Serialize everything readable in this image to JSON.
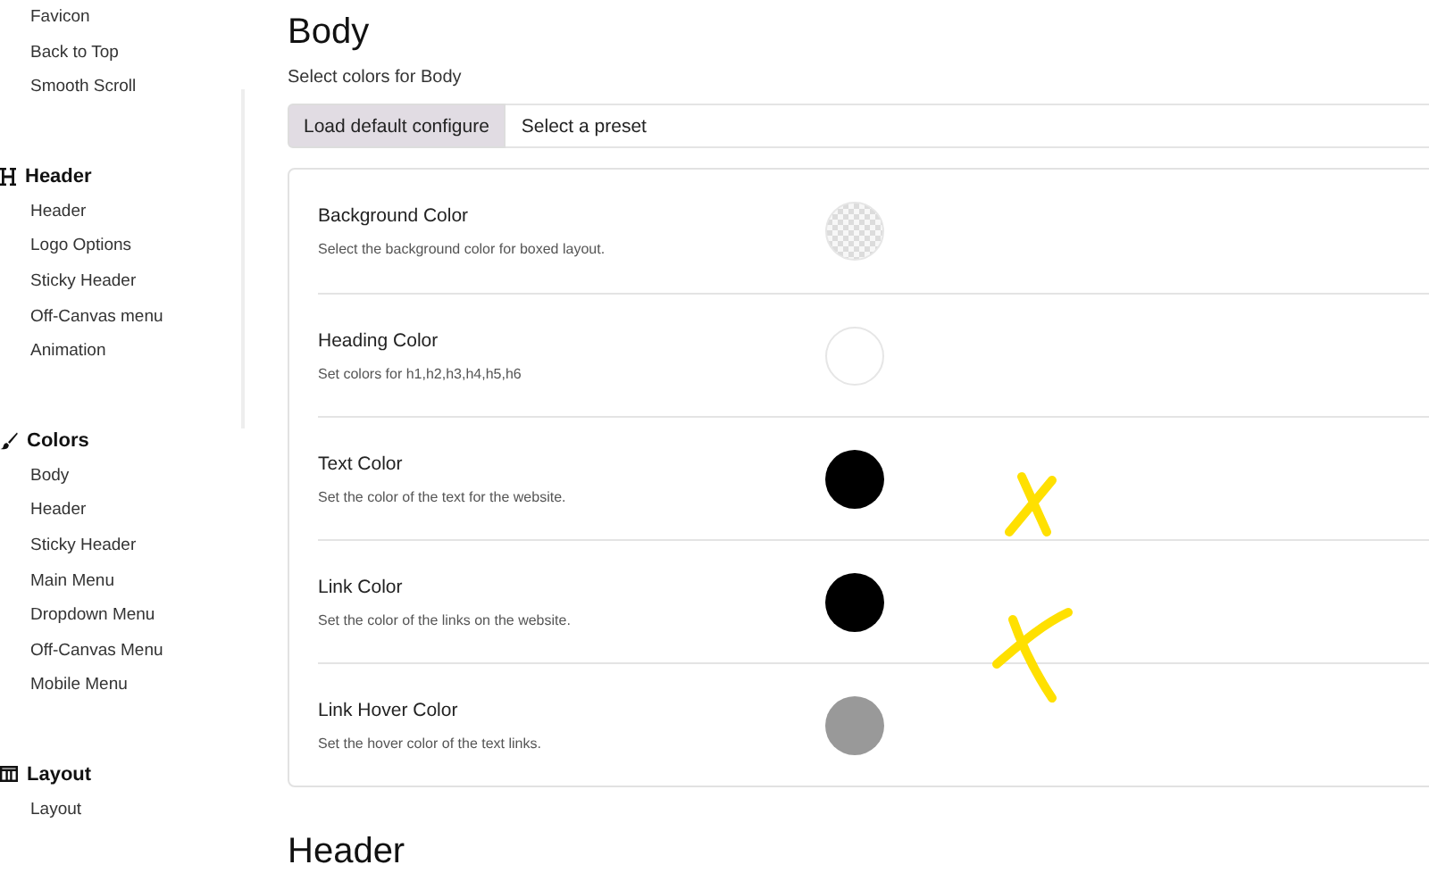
{
  "sidebar": {
    "top_items": [
      "Favicon",
      "Back to Top",
      "Smooth Scroll"
    ],
    "groups": [
      {
        "title": "Header",
        "items": [
          "Header",
          "Logo Options",
          "Sticky Header",
          "Off-Canvas menu",
          "Animation"
        ]
      },
      {
        "title": "Colors",
        "items": [
          "Body",
          "Header",
          "Sticky Header",
          "Main Menu",
          "Dropdown Menu",
          "Off-Canvas Menu",
          "Mobile Menu"
        ]
      },
      {
        "title": "Layout",
        "items": [
          "Layout"
        ]
      }
    ]
  },
  "section": {
    "title": "Body",
    "subtitle": "Select colors for Body",
    "default_button": "Load default configure",
    "preset_select": "Select a preset",
    "settings": [
      {
        "label": "Background Color",
        "description": "Select the background color for boxed layout.",
        "kind": "transparent"
      },
      {
        "label": "Heading Color",
        "description": "Set colors for h1,h2,h3,h4,h5,h6",
        "kind": "solid",
        "color": "#ffffff"
      },
      {
        "label": "Text Color",
        "description": "Set the color of the text for the website.",
        "kind": "solid",
        "color": "#000000"
      },
      {
        "label": "Link Color",
        "description": "Set the color of the links on the website.",
        "kind": "solid",
        "color": "#000000"
      },
      {
        "label": "Link Hover Color",
        "description": "Set the hover color of the text links.",
        "kind": "solid",
        "color": "#999999"
      }
    ]
  },
  "next_section": {
    "title": "Header"
  }
}
